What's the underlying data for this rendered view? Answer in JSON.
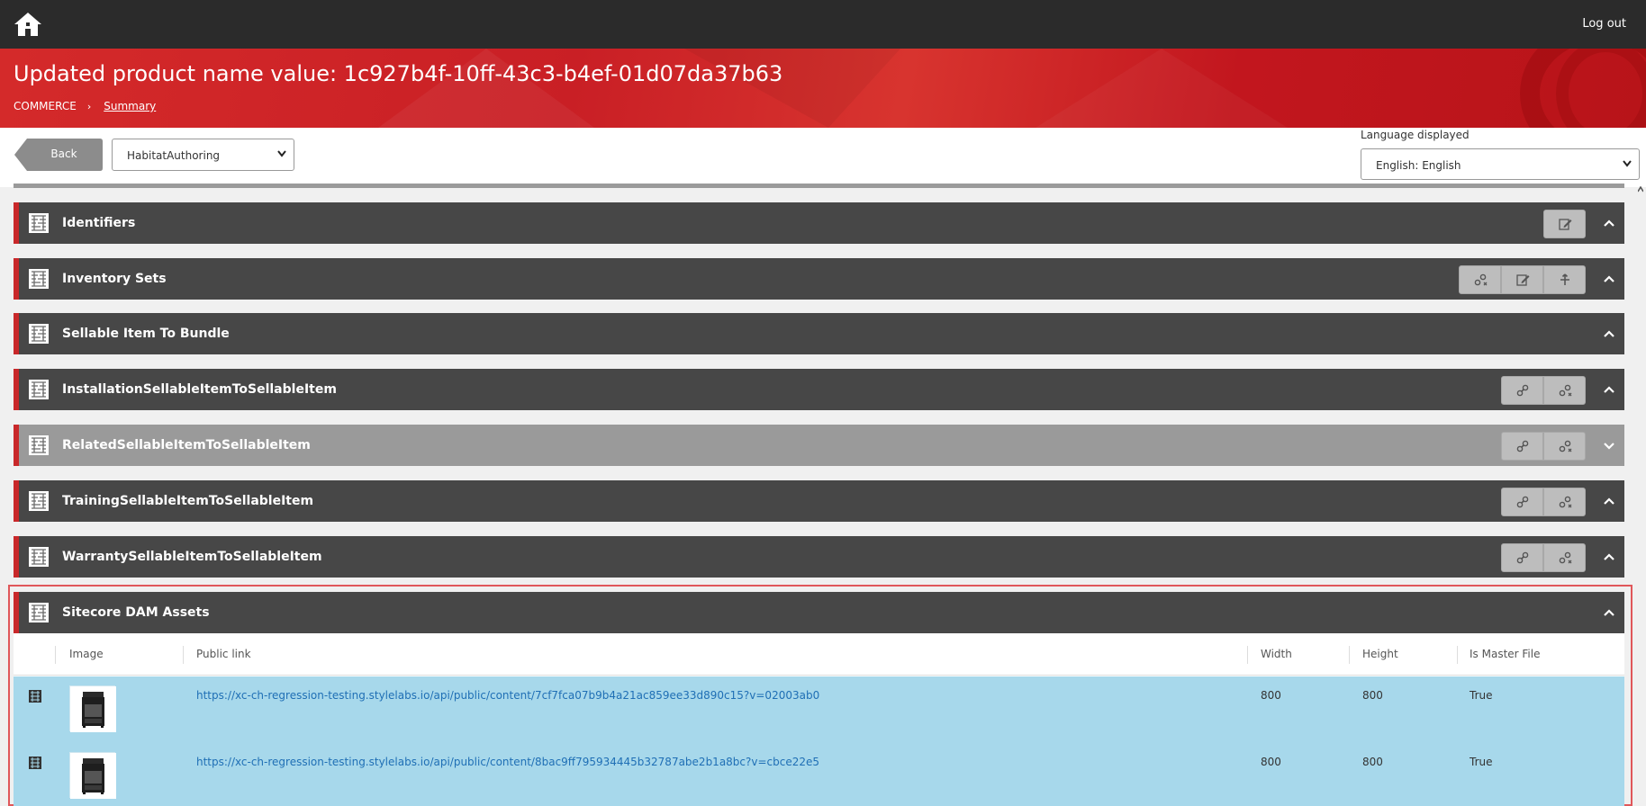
{
  "header": {
    "logout_label": "Log out"
  },
  "hero": {
    "title": "Updated product name value: 1c927b4f-10ff-43c3-b4ef-01d07da37b63",
    "breadcrumb": {
      "root": "COMMERCE",
      "current": "Summary"
    }
  },
  "toolbar": {
    "back_label": "Back",
    "environment_value": "HabitatAuthoring",
    "language_label": "Language displayed",
    "language_value": "English: English"
  },
  "sections": [
    {
      "title": "Identifiers",
      "buttons": [
        "edit-icon"
      ],
      "expanded": true
    },
    {
      "title": "Inventory Sets",
      "buttons": [
        "unlink-icon",
        "edit-icon",
        "add-icon"
      ],
      "expanded": true
    },
    {
      "title": "Sellable Item To Bundle",
      "buttons": [],
      "expanded": true
    },
    {
      "title": "InstallationSellableItemToSellableItem",
      "buttons": [
        "link-icon",
        "unlink-icon"
      ],
      "expanded": true
    },
    {
      "title": "RelatedSellableItemToSellableItem",
      "buttons": [
        "link-icon",
        "unlink-icon"
      ],
      "expanded": false
    },
    {
      "title": "TrainingSellableItemToSellableItem",
      "buttons": [
        "link-icon",
        "unlink-icon"
      ],
      "expanded": true
    },
    {
      "title": "WarrantySellableItemToSellableItem",
      "buttons": [
        "link-icon",
        "unlink-icon"
      ],
      "expanded": true
    },
    {
      "title": "Sitecore DAM Assets",
      "buttons": [],
      "expanded": true
    }
  ],
  "dam_table": {
    "columns": [
      "Image",
      "Public link",
      "Width",
      "Height",
      "Is Master File"
    ],
    "rows": [
      {
        "link": "https://xc-ch-regression-testing.stylelabs.io/api/public/content/7cf7fca07b9b4a21ac859ee33d890c15?v=02003ab0",
        "width": "800",
        "height": "800",
        "master": "True"
      },
      {
        "link": "https://xc-ch-regression-testing.stylelabs.io/api/public/content/8bac9ff795934445b32787abe2b1a8bc?v=cbce22e5",
        "width": "800",
        "height": "800",
        "master": "True"
      }
    ]
  },
  "colors": {
    "accent_red": "#c8282a",
    "section_dark": "#474747",
    "section_disabled": "#9a9a9a",
    "row_selected": "#a7d8eb",
    "link_blue": "#1f6fb5"
  }
}
